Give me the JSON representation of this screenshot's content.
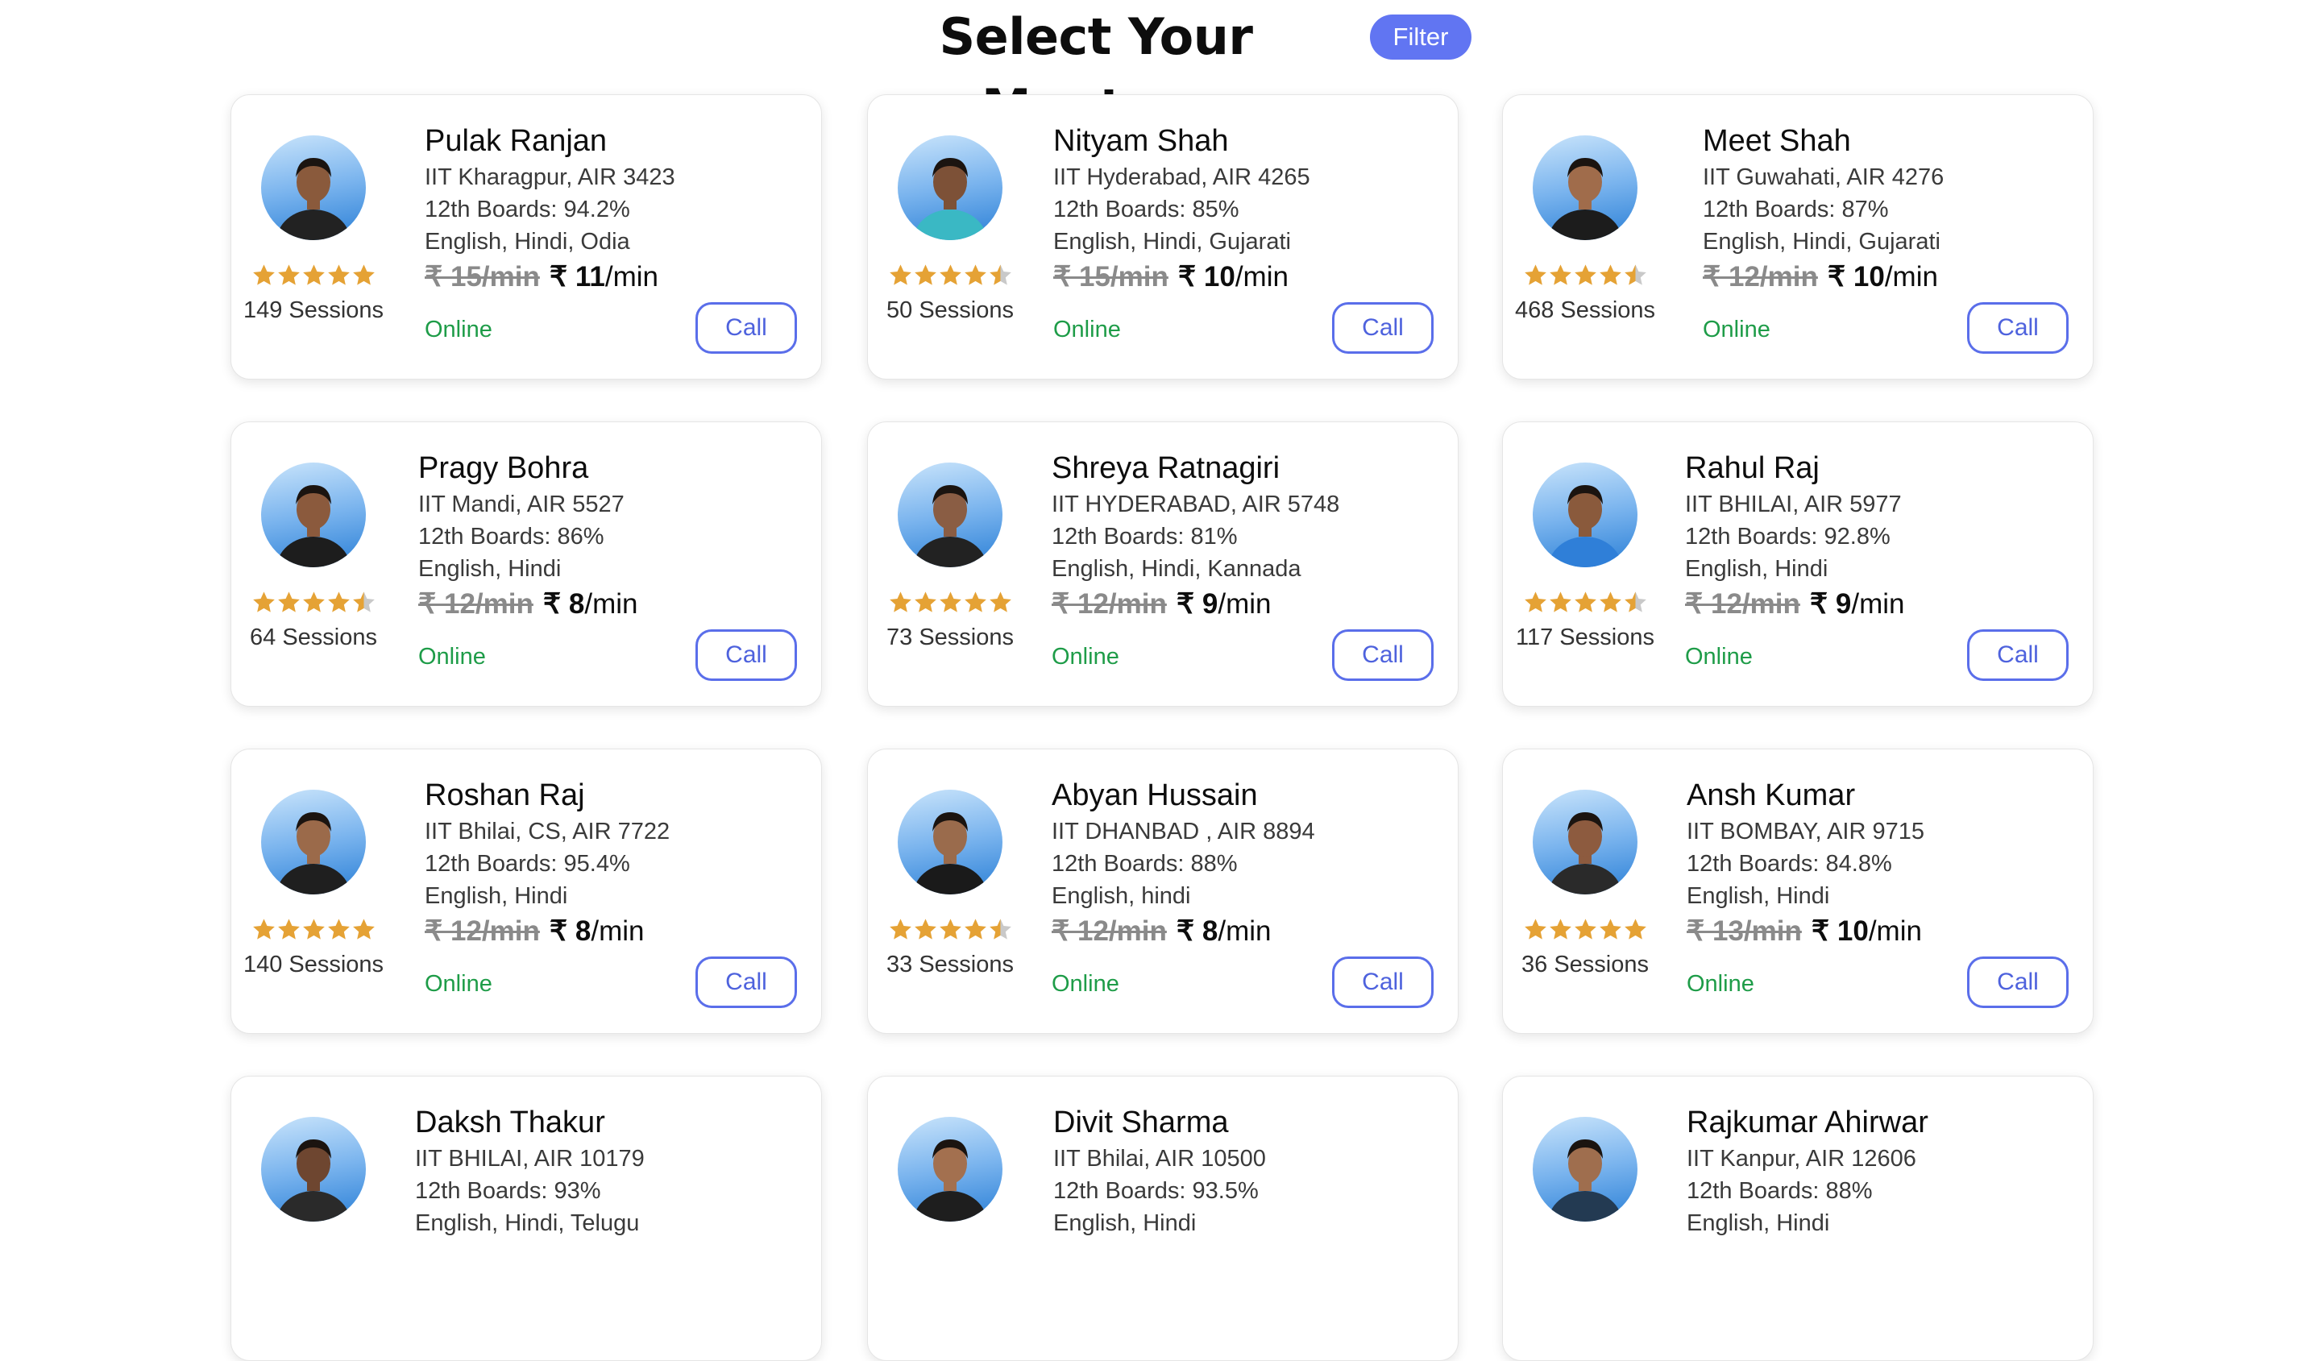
{
  "header": {
    "title": "Select Your Mentors",
    "filter_label": "Filter"
  },
  "colors": {
    "accent": "#6175f2",
    "online": "#1e9c48",
    "star": "#e5a235",
    "star_empty": "#c9c9c9"
  },
  "mentors": [
    {
      "name": "Pulak Ranjan",
      "college": "IIT Kharagpur, AIR 3423",
      "boards": "12th Boards: 94.2%",
      "languages": "English, Hindi, Odia",
      "old_price": "₹ 15/min",
      "new_price": "₹ 11",
      "per_min": "/min",
      "rating": 5,
      "sessions": "149 Sessions",
      "status": "Online",
      "call_label": "Call"
    },
    {
      "name": "Nityam Shah",
      "college": "IIT Hyderabad, AIR 4265",
      "boards": "12th Boards: 85%",
      "languages": "English, Hindi, Gujarati",
      "old_price": "₹ 15/min",
      "new_price": "₹ 10",
      "per_min": "/min",
      "rating": 4.5,
      "sessions": "50 Sessions",
      "status": "Online",
      "call_label": "Call"
    },
    {
      "name": "Meet Shah",
      "college": "IIT Guwahati, AIR 4276",
      "boards": "12th Boards: 87%",
      "languages": "English, Hindi, Gujarati",
      "old_price": "₹ 12/min",
      "new_price": "₹ 10",
      "per_min": "/min",
      "rating": 4.5,
      "sessions": "468 Sessions",
      "status": "Online",
      "call_label": "Call"
    },
    {
      "name": "Pragy Bohra",
      "college": "IIT Mandi, AIR 5527",
      "boards": "12th Boards: 86%",
      "languages": "English, Hindi",
      "old_price": "₹ 12/min",
      "new_price": "₹ 8",
      "per_min": "/min",
      "rating": 4.5,
      "sessions": "64 Sessions",
      "status": "Online",
      "call_label": "Call"
    },
    {
      "name": "Shreya Ratnagiri",
      "college": "IIT HYDERABAD, AIR 5748",
      "boards": "12th Boards: 81%",
      "languages": "English, Hindi, Kannada",
      "old_price": "₹ 12/min",
      "new_price": "₹ 9",
      "per_min": "/min",
      "rating": 5,
      "sessions": "73 Sessions",
      "status": "Online",
      "call_label": "Call"
    },
    {
      "name": "Rahul Raj",
      "college": "IIT BHILAI, AIR 5977",
      "boards": "12th Boards: 92.8%",
      "languages": "English, Hindi",
      "old_price": "₹ 12/min",
      "new_price": "₹ 9",
      "per_min": "/min",
      "rating": 4.5,
      "sessions": "117 Sessions",
      "status": "Online",
      "call_label": "Call"
    },
    {
      "name": "Roshan Raj",
      "college": "IIT Bhilai, CS, AIR 7722",
      "boards": "12th Boards: 95.4%",
      "languages": "English, Hindi",
      "old_price": "₹ 12/min",
      "new_price": "₹ 8",
      "per_min": "/min",
      "rating": 5,
      "sessions": "140 Sessions",
      "status": "Online",
      "call_label": "Call"
    },
    {
      "name": "Abyan Hussain",
      "college": "IIT DHANBAD , AIR 8894",
      "boards": "12th Boards: 88%",
      "languages": "English, hindi",
      "old_price": "₹ 12/min",
      "new_price": "₹ 8",
      "per_min": "/min",
      "rating": 4.5,
      "sessions": "33 Sessions",
      "status": "Online",
      "call_label": "Call"
    },
    {
      "name": "Ansh Kumar",
      "college": "IIT BOMBAY, AIR 9715",
      "boards": "12th Boards: 84.8%",
      "languages": "English, Hindi",
      "old_price": "₹ 13/min",
      "new_price": "₹ 10",
      "per_min": "/min",
      "rating": 5,
      "sessions": "36 Sessions",
      "status": "Online",
      "call_label": "Call"
    },
    {
      "name": "Daksh Thakur",
      "college": "IIT BHILAI, AIR 10179",
      "boards": "12th Boards: 93%",
      "languages": "English, Hindi, Telugu",
      "old_price": "",
      "new_price": "",
      "per_min": "",
      "rating": 0,
      "sessions": "",
      "status": "",
      "call_label": ""
    },
    {
      "name": "Divit Sharma",
      "college": "IIT Bhilai, AIR 10500",
      "boards": "12th Boards: 93.5%",
      "languages": "English, Hindi",
      "old_price": "",
      "new_price": "",
      "per_min": "",
      "rating": 0,
      "sessions": "",
      "status": "",
      "call_label": ""
    },
    {
      "name": "Rajkumar Ahirwar",
      "college": "IIT Kanpur, AIR 12606",
      "boards": "12th Boards: 88%",
      "languages": "English, Hindi",
      "old_price": "",
      "new_price": "",
      "per_min": "",
      "rating": 0,
      "sessions": "",
      "status": "",
      "call_label": ""
    }
  ]
}
